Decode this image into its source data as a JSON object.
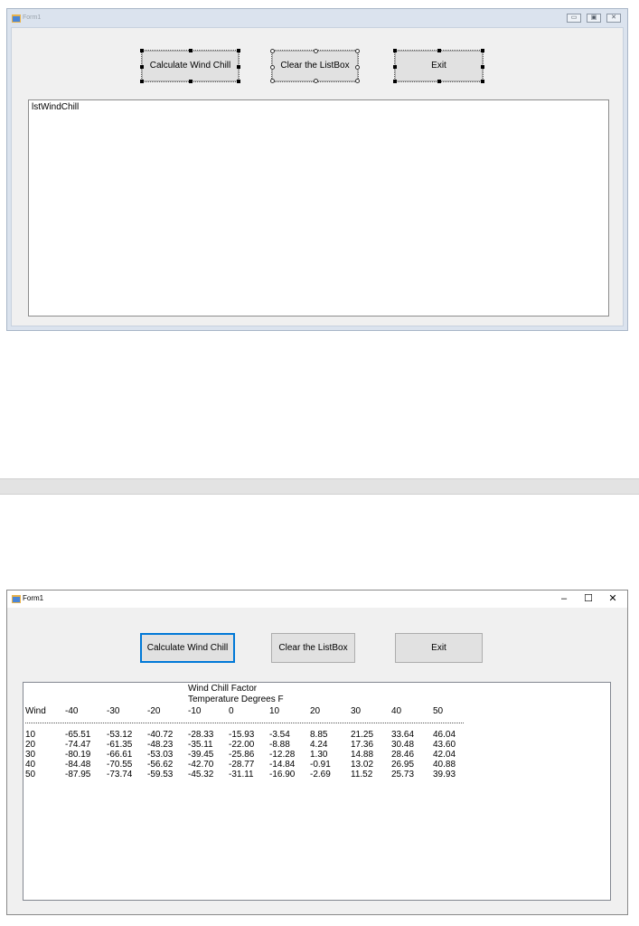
{
  "designer": {
    "title": "Form1",
    "window_controls": [
      "▭",
      "▣",
      "✕"
    ],
    "buttons": {
      "calculate": "Calculate Wind Chill",
      "clear": "Clear the ListBox",
      "exit": "Exit"
    },
    "listbox_name": "lstWindChill"
  },
  "runtime": {
    "title": "Form1",
    "window_controls": [
      "–",
      "☐",
      "✕"
    ],
    "buttons": {
      "calculate": "Calculate Wind Chill",
      "clear": "Clear the ListBox",
      "exit": "Exit"
    },
    "list": {
      "title_line1": "Wind Chill Factor",
      "title_line2": "Temperature Degrees F",
      "header": [
        "Wind",
        "-40",
        "-30",
        "-20",
        "-10",
        "0",
        "10",
        "20",
        "30",
        "40",
        "50"
      ],
      "rows": [
        [
          "10",
          "-65.51",
          "-53.12",
          "-40.72",
          "-28.33",
          "-15.93",
          "-3.54",
          "8.85",
          "21.25",
          "33.64",
          "46.04"
        ],
        [
          "20",
          "-74.47",
          "-61.35",
          "-48.23",
          "-35.11",
          "-22.00",
          "-8.88",
          "4.24",
          "17.36",
          "30.48",
          "43.60"
        ],
        [
          "30",
          "-80.19",
          "-66.61",
          "-53.03",
          "-39.45",
          "-25.86",
          "-12.28",
          "1.30",
          "14.88",
          "28.46",
          "42.04"
        ],
        [
          "40",
          "-84.48",
          "-70.55",
          "-56.62",
          "-42.70",
          "-28.77",
          "-14.84",
          "-0.91",
          "13.02",
          "26.95",
          "40.88"
        ],
        [
          "50",
          "-87.95",
          "-73.74",
          "-59.53",
          "-45.32",
          "-31.11",
          "-16.90",
          "-2.69",
          "11.52",
          "25.73",
          "39.93"
        ]
      ]
    }
  }
}
